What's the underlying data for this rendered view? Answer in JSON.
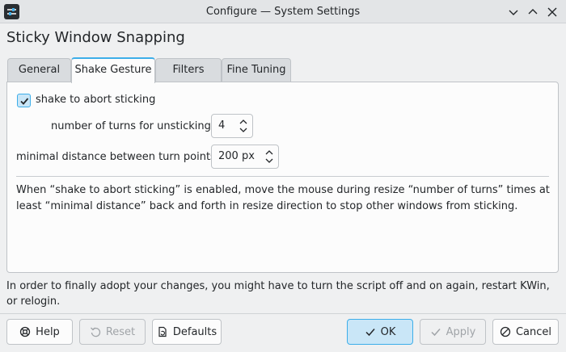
{
  "window": {
    "title": "Configure — System Settings"
  },
  "page": {
    "title": "Sticky Window Snapping"
  },
  "tabs": [
    {
      "label": "General"
    },
    {
      "label": "Shake Gesture"
    },
    {
      "label": "Filters"
    },
    {
      "label": "Fine Tuning"
    }
  ],
  "active_tab": "Shake Gesture",
  "shake": {
    "checkbox_label": "shake to abort sticking",
    "checked": true,
    "turns_label": "number of turns for unsticking:",
    "turns_value": "4",
    "distance_label": "minimal distance between turn points:",
    "distance_value": "200 px",
    "description": "When “shake to abort sticking” is enabled, move the mouse during resize “number of turns” times at least “minimal distance” back and forth in resize direction to stop other windows from sticking."
  },
  "footnote": "In order to finally adopt your changes, you might have to turn the script off and on again, restart KWin, or relogin.",
  "buttons": {
    "help": "Help",
    "reset": "Reset",
    "defaults": "Defaults",
    "ok": "OK",
    "apply": "Apply",
    "cancel": "Cancel"
  },
  "colors": {
    "accent": "#3daee9",
    "background": "#eff0f1",
    "panel": "#fcfcfc"
  }
}
